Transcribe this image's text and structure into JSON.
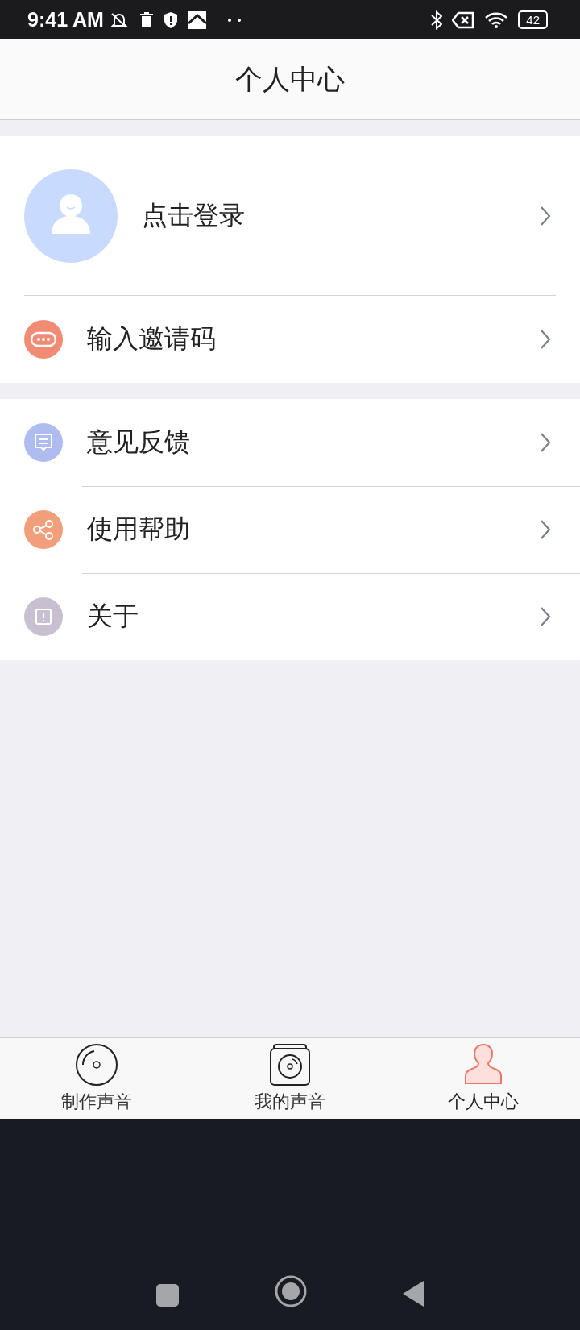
{
  "status_bar": {
    "time": "9:41 AM",
    "battery": "42"
  },
  "header": {
    "title": "个人中心"
  },
  "profile": {
    "login_label": "点击登录"
  },
  "menu_groups": [
    [
      {
        "kind": "invite",
        "label": "输入邀请码",
        "color": "#f28b74"
      }
    ],
    [
      {
        "kind": "feedback",
        "label": "意见反馈",
        "color": "#aebcf0"
      },
      {
        "kind": "share",
        "label": "使用帮助",
        "color": "#f19e7b"
      },
      {
        "kind": "about",
        "label": "关于",
        "color": "#c8bfd0"
      }
    ]
  ],
  "tabs": [
    {
      "kind": "disc",
      "label": "制作声音",
      "selected": false
    },
    {
      "kind": "album",
      "label": "我的声音",
      "selected": false
    },
    {
      "kind": "person",
      "label": "个人中心",
      "selected": true
    }
  ]
}
